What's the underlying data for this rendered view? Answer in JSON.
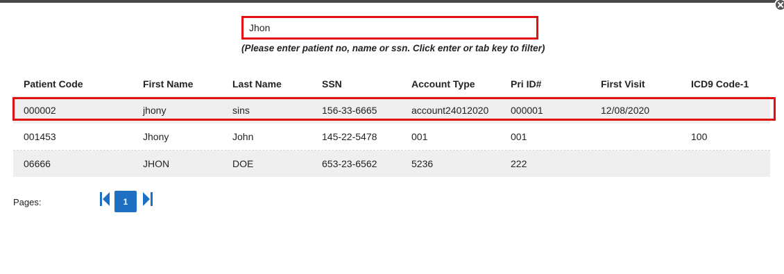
{
  "search": {
    "value": "Jhon",
    "hint": "(Please enter patient no, name or ssn. Click enter or tab key to filter)"
  },
  "table": {
    "headers": [
      "Patient Code",
      "First Name",
      "Last Name",
      "SSN",
      "Account Type",
      "Pri ID#",
      "First Visit",
      "ICD9 Code-1"
    ],
    "rows": [
      [
        "000002",
        "jhony",
        "sins",
        "156-33-6665",
        "account24012020",
        "000001",
        "12/08/2020",
        ""
      ],
      [
        "001453",
        "Jhony",
        "John",
        "145-22-5478",
        "001",
        "001",
        "",
        "100"
      ],
      [
        "06666",
        "JHON",
        "DOE",
        "653-23-6562",
        "5236",
        "222",
        "",
        ""
      ]
    ],
    "selected_row_index": 0
  },
  "pager": {
    "label": "Pages:",
    "current_page": "1"
  },
  "colors": {
    "highlight": "#e01010",
    "accent": "#1f6fc2",
    "alt_row": "#efefef"
  }
}
